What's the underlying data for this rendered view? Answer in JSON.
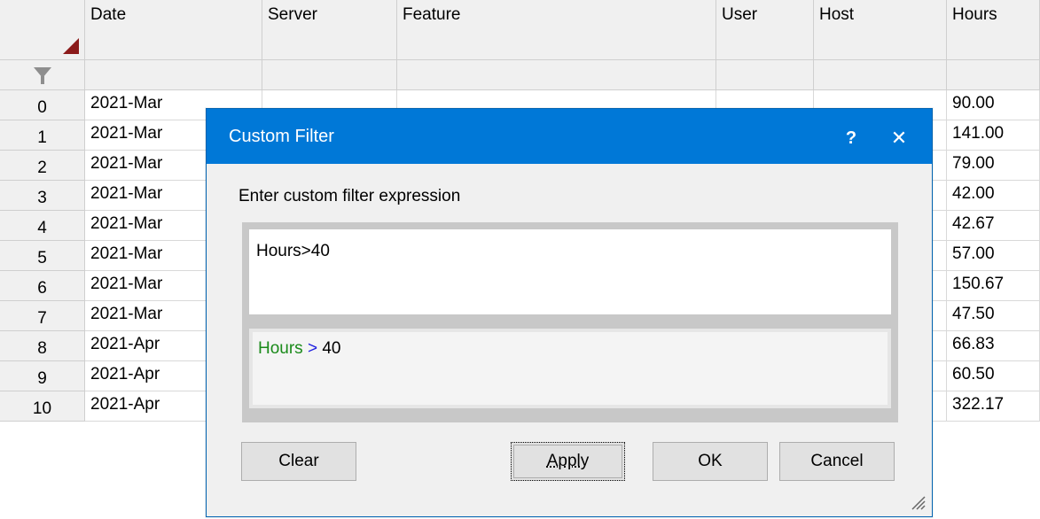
{
  "grid": {
    "columns": [
      "Date",
      "Server",
      "Feature",
      "User",
      "Host",
      "Hours"
    ],
    "rows": [
      {
        "n": "0",
        "date": "2021-Mar",
        "hours": "90.00"
      },
      {
        "n": "1",
        "date": "2021-Mar",
        "hours": "141.00"
      },
      {
        "n": "2",
        "date": "2021-Mar",
        "hours": "79.00"
      },
      {
        "n": "3",
        "date": "2021-Mar",
        "hours": "42.00"
      },
      {
        "n": "4",
        "date": "2021-Mar",
        "hours": "42.67"
      },
      {
        "n": "5",
        "date": "2021-Mar",
        "hours": "57.00"
      },
      {
        "n": "6",
        "date": "2021-Mar",
        "hours": "150.67"
      },
      {
        "n": "7",
        "date": "2021-Mar",
        "hours": "47.50"
      },
      {
        "n": "8",
        "date": "2021-Apr",
        "hours": "66.83"
      },
      {
        "n": "9",
        "date": "2021-Apr",
        "hours": "60.50"
      },
      {
        "n": "10",
        "date": "2021-Apr",
        "hours": "322.17"
      }
    ]
  },
  "dialog": {
    "title": "Custom Filter",
    "help_label": "?",
    "close_label": "✕",
    "prompt": "Enter custom filter expression",
    "expression": "Hours>40",
    "preview": {
      "field": "Hours",
      "op": ">",
      "value": "40"
    },
    "buttons": {
      "clear": "Clear",
      "apply": "Apply",
      "ok": "OK",
      "cancel": "Cancel"
    }
  }
}
